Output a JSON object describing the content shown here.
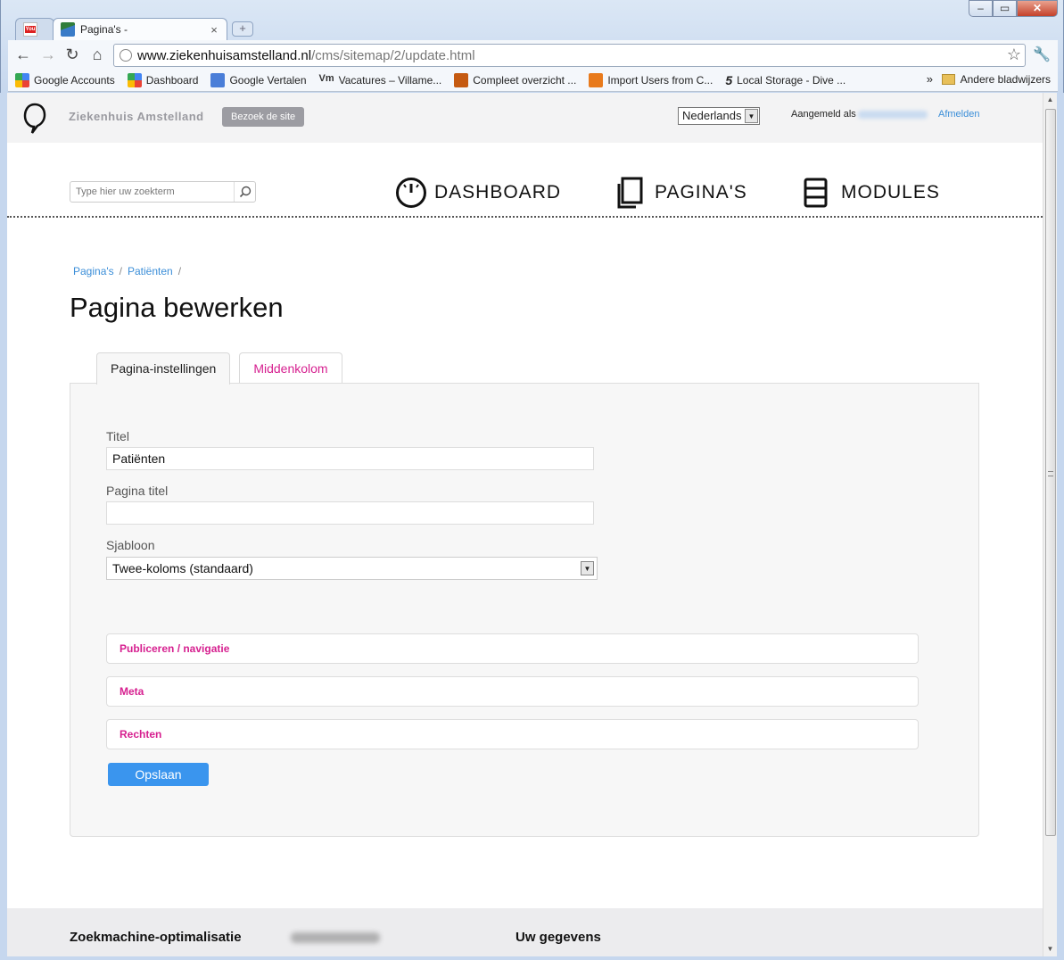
{
  "browser": {
    "tabs": [
      {
        "title": "",
        "icon": "youtube-icon"
      },
      {
        "title": "Pagina's -",
        "icon": "site-favicon"
      }
    ],
    "url_host": "www.ziekenhuisamstelland.nl",
    "url_path": "/cms/sitemap/2/update.html",
    "bookmarks": [
      {
        "label": "Google Accounts"
      },
      {
        "label": "Dashboard"
      },
      {
        "label": "Google Vertalen"
      },
      {
        "label": "Vacatures – Villame..."
      },
      {
        "label": "Compleet overzicht ..."
      },
      {
        "label": "Import Users from C..."
      },
      {
        "label": "Local Storage - Dive ..."
      }
    ],
    "bookmarks_more": "»",
    "other_bookmarks": "Andere bladwijzers"
  },
  "header": {
    "site_name": "Ziekenhuis Amstelland",
    "visit_button": "Bezoek de site",
    "language": "Nederlands",
    "logged_in_as": "Aangemeld als",
    "logout": "Afmelden",
    "search_placeholder": "Type hier uw zoekterm"
  },
  "nav": {
    "dashboard": "DASHBOARD",
    "pages": "PAGINA'S",
    "modules": "MODULES"
  },
  "breadcrumb": {
    "items": [
      "Pagina's",
      "Patiënten"
    ],
    "separator": "/"
  },
  "page": {
    "title": "Pagina bewerken",
    "tabs": [
      "Pagina-instellingen",
      "Middenkolom"
    ]
  },
  "form": {
    "title_label": "Titel",
    "title_value": "Patiënten",
    "page_title_label": "Pagina titel",
    "page_title_value": "",
    "template_label": "Sjabloon",
    "template_value": "Twee-koloms (standaard)",
    "sections": [
      "Publiceren / navigatie",
      "Meta",
      "Rechten"
    ],
    "save_label": "Opslaan"
  },
  "footer": {
    "col1": "Zoekmachine-optimalisatie",
    "col2": "Uw gegevens"
  },
  "colors": {
    "accent_pink": "#d61f8f",
    "link_blue": "#3b8ed8",
    "button_blue": "#3a95ee"
  }
}
